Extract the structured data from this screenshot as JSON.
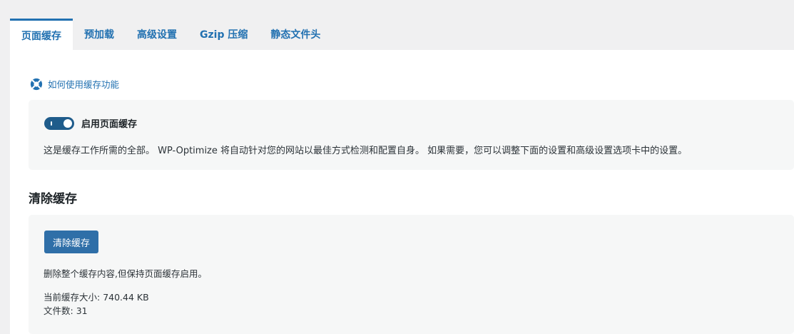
{
  "tabs": [
    {
      "label": "页面缓存",
      "active": true
    },
    {
      "label": "预加载",
      "active": false
    },
    {
      "label": "高级设置",
      "active": false
    },
    {
      "label": "Gzip 压缩",
      "active": false
    },
    {
      "label": "静态文件头",
      "active": false
    }
  ],
  "help": {
    "label": "如何使用缓存功能",
    "icon": "lifebuoy-icon"
  },
  "enable_cache": {
    "label": "启用页面缓存",
    "enabled": true,
    "description": "这是缓存工作所需的全部。 WP-Optimize 将自动针对您的网站以最佳方式检测和配置自身。 如果需要，您可以调整下面的设置和高级设置选项卡中的设置。"
  },
  "purge": {
    "section_title": "清除缓存",
    "button_label": "清除缓存",
    "description": "删除整个缓存内容,但保持页面缓存启用。",
    "cache_size_label": "当前缓存大小:",
    "cache_size_value": "740.44 KB",
    "file_count_label": "文件数:",
    "file_count_value": "31"
  },
  "colors": {
    "accent": "#2271b1",
    "toggle_on": "#1f5c8b",
    "button": "#2f6fa8",
    "page_bg": "#f0f0f1",
    "box_bg": "#f6f7f7"
  }
}
